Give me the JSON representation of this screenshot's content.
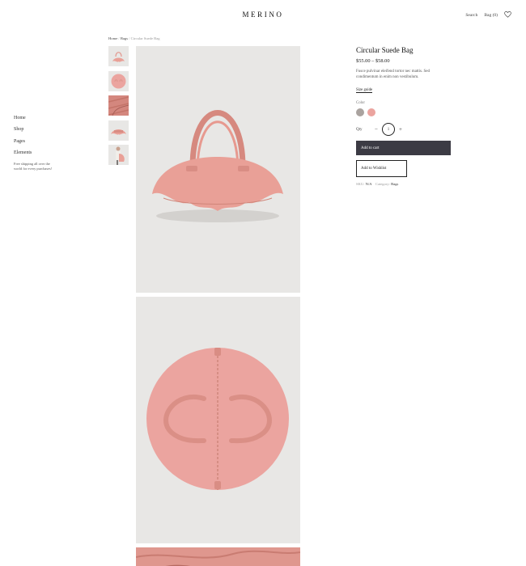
{
  "header": {
    "logo": "MERINO",
    "search_label": "Search",
    "bag_label": "Bag (0)",
    "wishlist_icon": "heart-icon"
  },
  "sidebar": {
    "items": [
      {
        "label": "Home"
      },
      {
        "label": "Shop"
      },
      {
        "label": "Pages"
      },
      {
        "label": "Elements"
      }
    ],
    "promo": "Free shipping all over the world for every purchases!"
  },
  "breadcrumb": {
    "home": "Home",
    "sep1": " / ",
    "category": "Bags",
    "sep2": " / ",
    "current": "Circular Suede Bag"
  },
  "product": {
    "title": "Circular Suede Bag",
    "price": "$55.00 – $58.00",
    "description": "Fusce pulvinar eleifend tortor nec mattis. Sed condimentum in enim non vestibulum.",
    "size_guide": "Size guide",
    "color_label": "Color",
    "colors": [
      "#aaa39f",
      "#eba49f"
    ],
    "qty_label": "Qty",
    "qty_value": "1",
    "qty_minus": "−",
    "qty_plus": "+",
    "add_to_cart": "Add to cart",
    "add_to_wishlist": "Add to Wishlist",
    "sku_label": "SKU: ",
    "sku_value": "N/A",
    "category_label": "Category: ",
    "category_value": "Bags"
  },
  "colors": {
    "bag_pink": "#e9a097",
    "image_bg": "#e8e7e5",
    "button_dark": "#3c3b44"
  }
}
